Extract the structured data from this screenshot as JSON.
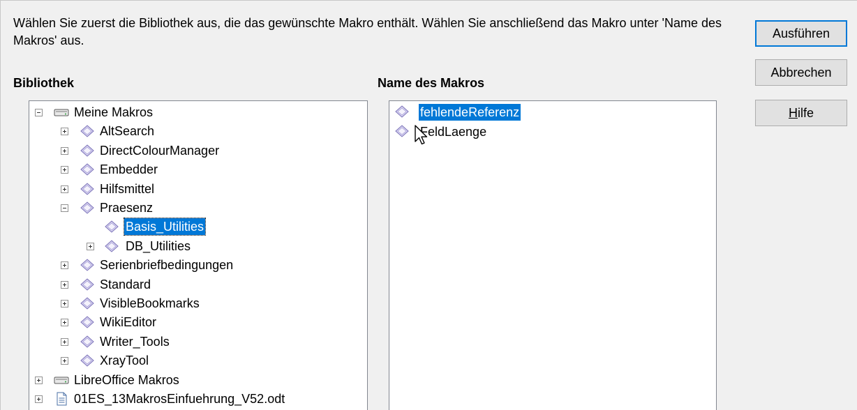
{
  "instruction": "Wählen Sie zuerst die Bibliothek aus, die das gewünschte Makro enthält. Wählen Sie anschließend das Makro unter 'Name des Makros' aus.",
  "library_label": "Bibliothek",
  "macro_name_label": "Name des Makros",
  "buttons": {
    "run": "Ausführen",
    "cancel": "Abbrechen",
    "help_mnemonic": "H",
    "help_rest": "ilfe"
  },
  "library_tree": [
    {
      "label": "Meine Makros",
      "level": 0,
      "icon": "drive-icon",
      "expander": "minus"
    },
    {
      "label": "AltSearch",
      "level": 1,
      "icon": "library-icon",
      "expander": "plus"
    },
    {
      "label": "DirectColourManager",
      "level": 1,
      "icon": "library-icon",
      "expander": "plus"
    },
    {
      "label": "Embedder",
      "level": 1,
      "icon": "library-icon",
      "expander": "plus"
    },
    {
      "label": "Hilfsmittel",
      "level": 1,
      "icon": "library-icon",
      "expander": "plus"
    },
    {
      "label": "Praesenz",
      "level": 1,
      "icon": "library-icon",
      "expander": "minus"
    },
    {
      "label": "Basis_Utilities",
      "level": 2,
      "icon": "module-icon",
      "expander": "none",
      "selected": true
    },
    {
      "label": "DB_Utilities",
      "level": 2,
      "icon": "module-icon",
      "expander": "plus"
    },
    {
      "label": "Serienbriefbedingungen",
      "level": 1,
      "icon": "library-icon",
      "expander": "plus"
    },
    {
      "label": "Standard",
      "level": 1,
      "icon": "library-icon",
      "expander": "plus"
    },
    {
      "label": "VisibleBookmarks",
      "level": 1,
      "icon": "library-icon",
      "expander": "plus"
    },
    {
      "label": "WikiEditor",
      "level": 1,
      "icon": "library-icon",
      "expander": "plus"
    },
    {
      "label": "Writer_Tools",
      "level": 1,
      "icon": "library-icon",
      "expander": "plus"
    },
    {
      "label": "XrayTool",
      "level": 1,
      "icon": "library-icon",
      "expander": "plus"
    },
    {
      "label": "LibreOffice Makros",
      "level": 0,
      "icon": "drive-icon",
      "expander": "plus"
    },
    {
      "label": "01ES_13MakrosEinfuehrung_V52.odt",
      "level": 0,
      "icon": "document-icon",
      "expander": "plus"
    }
  ],
  "macro_list": [
    {
      "label": "fehlendeReferenz",
      "selected": true,
      "icon": "macro-icon"
    },
    {
      "label": "FeldLaenge",
      "selected": false,
      "icon": "macro-icon"
    }
  ],
  "colors": {
    "selection": "#0078d7",
    "background": "#f0f0f0"
  }
}
